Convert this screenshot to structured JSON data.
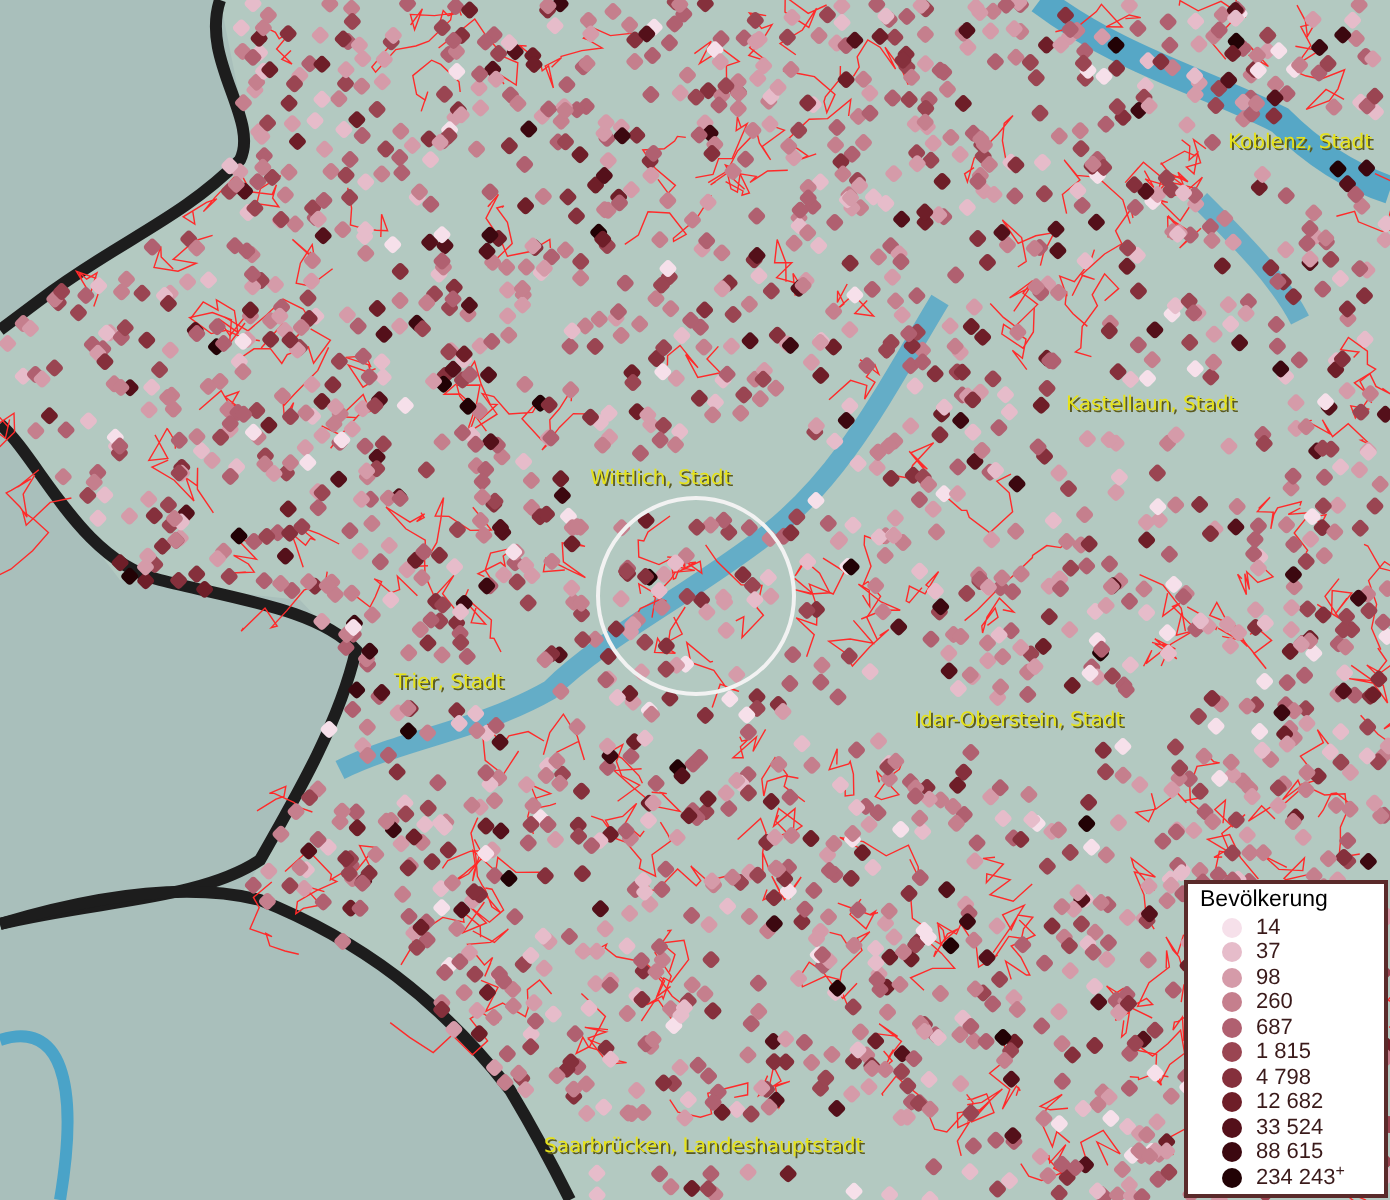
{
  "map": {
    "labels": [
      {
        "text": "Koblenz, Stadt"
      },
      {
        "text": "Kastellaun, Stadt"
      },
      {
        "text": "Wittlich, Stadt"
      },
      {
        "text": "Trier, Stadt"
      },
      {
        "text": "Idar-Oberstein, Stadt"
      },
      {
        "text": "Saarbrücken, Landeshauptstadt"
      }
    ]
  },
  "legend": {
    "title": "Bevölkerung",
    "items": [
      {
        "label": "14",
        "color": "#f6e0ea"
      },
      {
        "label": "37",
        "color": "#e6bcca"
      },
      {
        "label": "98",
        "color": "#d59ba9"
      },
      {
        "label": "260",
        "color": "#c57f8d"
      },
      {
        "label": "687",
        "color": "#b06070"
      },
      {
        "label": "1 815",
        "color": "#9a4552"
      },
      {
        "label": "4 798",
        "color": "#85303c"
      },
      {
        "label": "12 682",
        "color": "#6e1e28"
      },
      {
        "label": "33 524",
        "color": "#54101a"
      },
      {
        "label": "88 615",
        "color": "#3c0810"
      },
      {
        "label": "234 243$^{+}$",
        "color": "#220205"
      }
    ]
  }
}
